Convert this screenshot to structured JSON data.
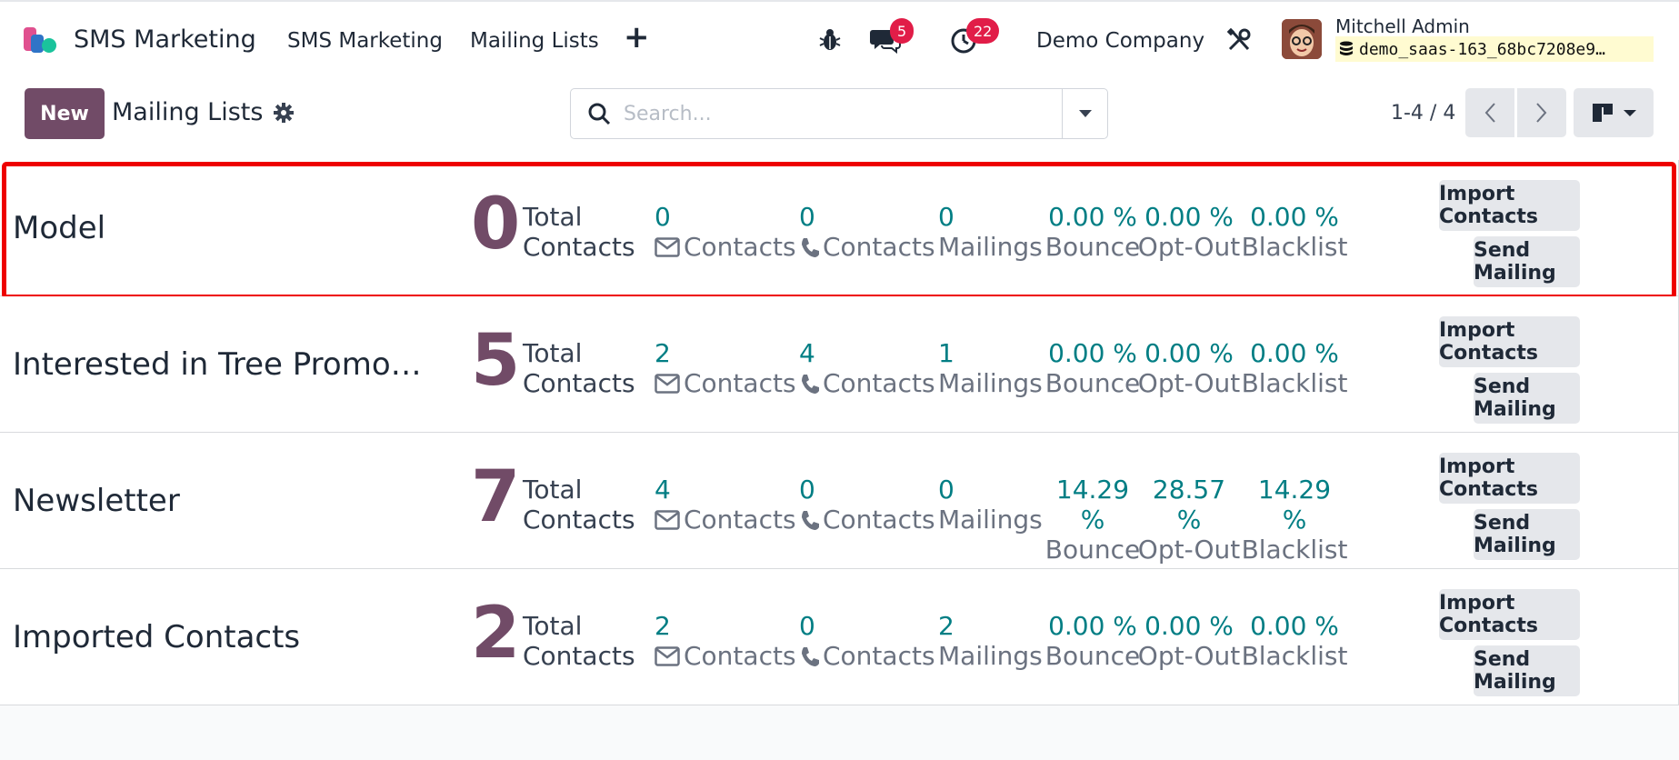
{
  "navbar": {
    "app_name": "SMS Marketing",
    "menu": [
      "SMS Marketing",
      "Mailing Lists"
    ],
    "plus_icon": "plus-icon",
    "messages_count": "5",
    "activities_count": "22",
    "company": "Demo Company",
    "user_name": "Mitchell Admin",
    "database": "demo_saas-163_68bc7208e9…"
  },
  "control": {
    "new_label": "New",
    "title": "Mailing Lists",
    "search_placeholder": "Search...",
    "pager": "1-4 / 4"
  },
  "colors": {
    "brand": "#714b67",
    "stat_value": "#017e84",
    "badge": "#e11d48",
    "highlight": "#ee0000"
  },
  "labels": {
    "total_top": "Total",
    "total_bottom": "Contacts",
    "email_contacts": "Contacts",
    "sms_contacts": "Contacts",
    "mailings": "Mailings",
    "bounce": "Bounce",
    "opt_out": "Opt-Out",
    "blacklist": "Blacklist",
    "import": "Import Contacts",
    "send": "Send Mailing"
  },
  "rows": [
    {
      "name": "Model",
      "total": "0",
      "email_contacts": "0",
      "sms_contacts": "0",
      "mailings": "0",
      "bounce": "0.00 %",
      "opt_out": "0.00 %",
      "blacklist": "0.00 %"
    },
    {
      "name": "Interested in Tree Promot…",
      "total": "5",
      "email_contacts": "2",
      "sms_contacts": "4",
      "mailings": "1",
      "bounce": "0.00 %",
      "opt_out": "0.00 %",
      "blacklist": "0.00 %"
    },
    {
      "name": "Newsletter",
      "total": "7",
      "email_contacts": "4",
      "sms_contacts": "0",
      "mailings": "0",
      "bounce": "14.29 %",
      "opt_out": "28.57 %",
      "blacklist": "14.29 %"
    },
    {
      "name": "Imported Contacts",
      "total": "2",
      "email_contacts": "2",
      "sms_contacts": "0",
      "mailings": "2",
      "bounce": "0.00 %",
      "opt_out": "0.00 %",
      "blacklist": "0.00 %"
    }
  ]
}
